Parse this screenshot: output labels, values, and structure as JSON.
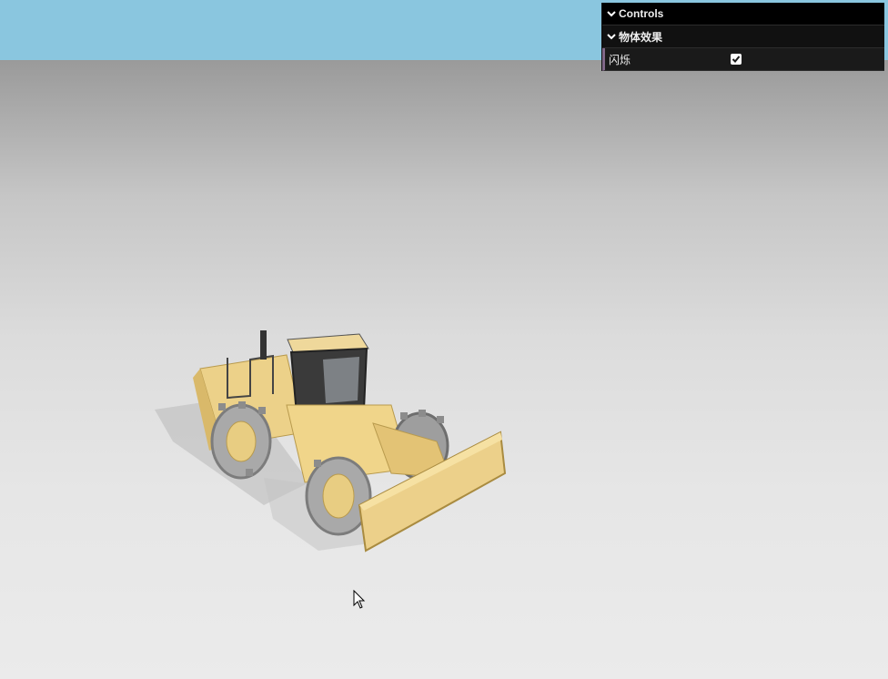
{
  "gui": {
    "title": "Controls",
    "folder": {
      "name": "物体效果",
      "properties": [
        {
          "label": "闪烁",
          "checked": true
        }
      ]
    }
  },
  "icons": {
    "collapse": "chevron-down-icon",
    "check": "check-icon",
    "cursor": "mouse-pointer-icon"
  },
  "colors": {
    "sky": "#8ac6df",
    "gui_background": "#1a1a1a",
    "gui_title_background": "#000000",
    "model_yellow": "#f0d58a"
  }
}
